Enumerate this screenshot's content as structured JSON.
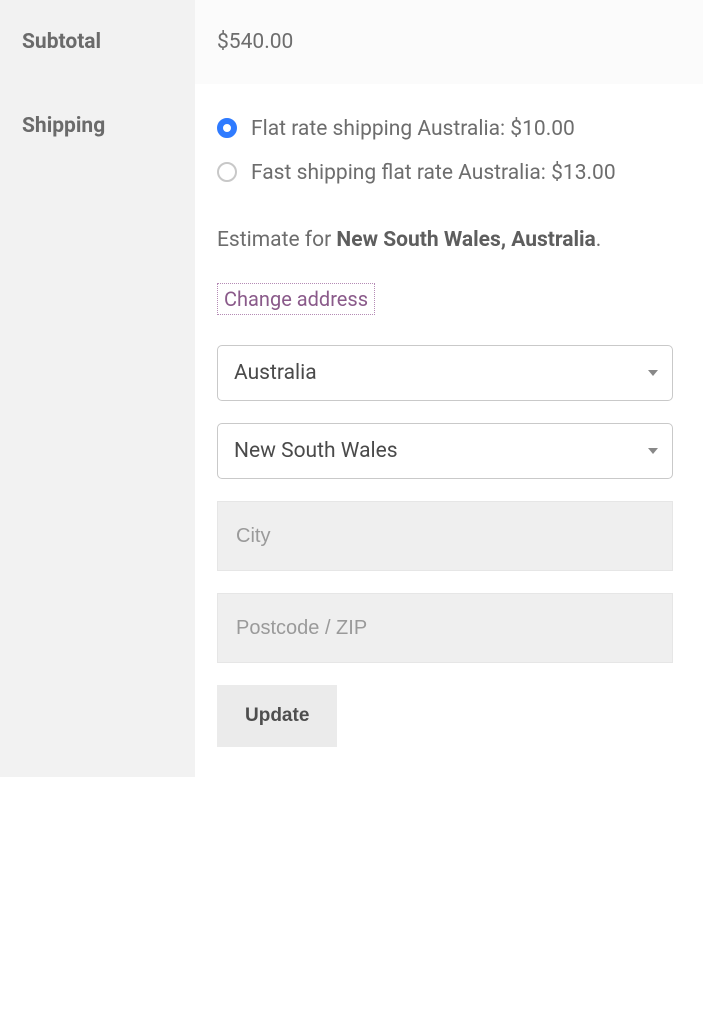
{
  "subtotal": {
    "label": "Subtotal",
    "value": "$540.00"
  },
  "shipping": {
    "label": "Shipping",
    "options": [
      {
        "label": "Flat rate shipping Australia: $10.00",
        "selected": true
      },
      {
        "label": "Fast shipping flat rate Australia: $13.00",
        "selected": false
      }
    ],
    "estimate_prefix": "Estimate for ",
    "estimate_location": "New South Wales, Australia",
    "estimate_suffix": ".",
    "change_address_label": "Change address",
    "country_value": "Australia",
    "state_value": "New South Wales",
    "city_placeholder": "City",
    "postcode_placeholder": "Postcode / ZIP",
    "update_label": "Update"
  }
}
